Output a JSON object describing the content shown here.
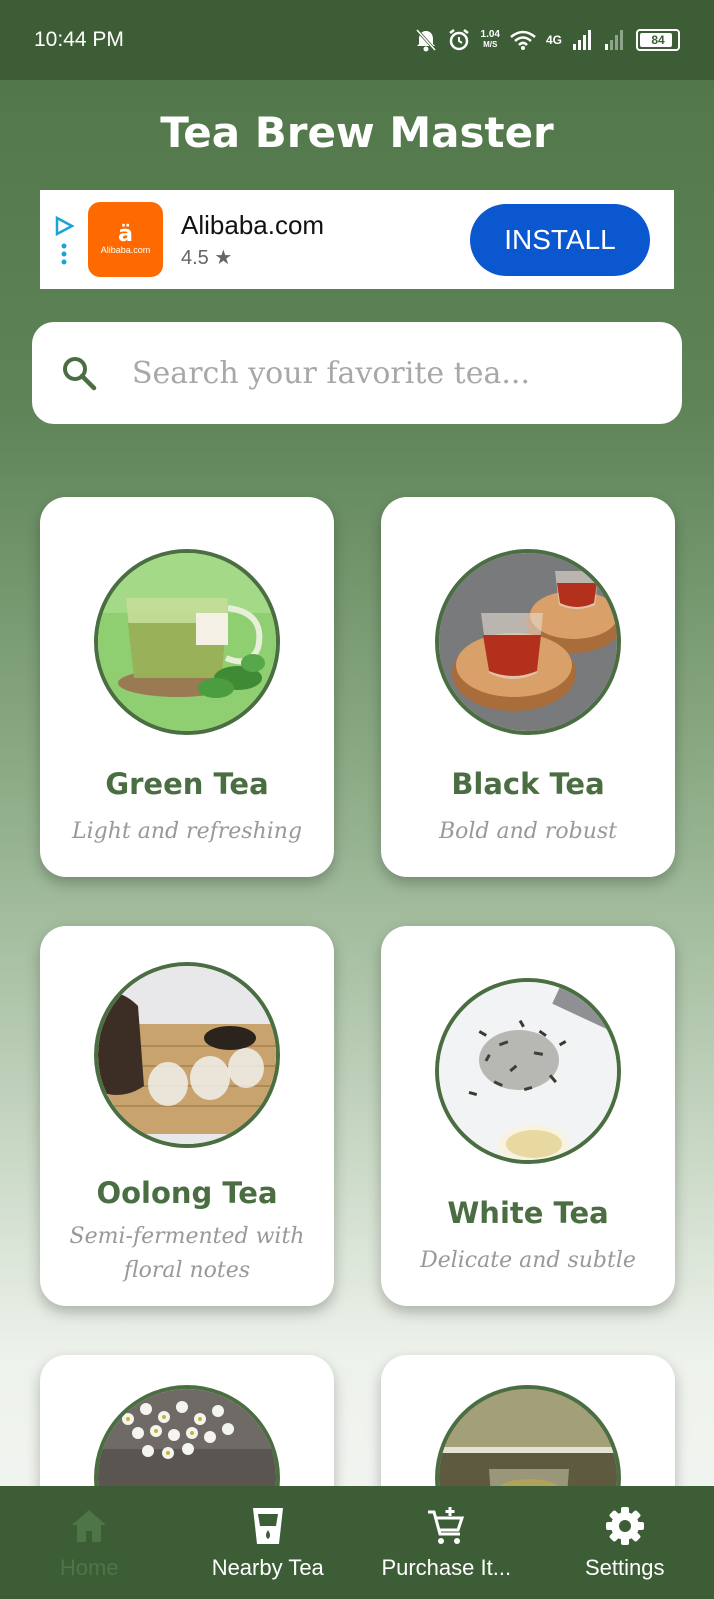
{
  "status": {
    "time": "10:44 PM",
    "speed_top": "1.04",
    "speed_unit": "M/S",
    "network": "4G",
    "battery": "84"
  },
  "app": {
    "title": "Tea Brew Master"
  },
  "ad": {
    "brand": "Alibaba.com",
    "logo_glyph": "ä",
    "logo_text": "Alibaba.com",
    "rating": "4.5 ★",
    "install_label": "INSTALL",
    "logo_color": "#ff6a00",
    "button_color": "#0b57d0"
  },
  "search": {
    "placeholder": "Search your favorite tea..."
  },
  "teas": [
    {
      "name": "Green Tea",
      "desc": "Light and refreshing",
      "image": "green-tea-cup"
    },
    {
      "name": "Black Tea",
      "desc": "Bold and robust",
      "image": "black-tea-glasses"
    },
    {
      "name": "Oolong Tea",
      "desc": "Semi-fermented with floral notes",
      "image": "oolong-tea-set"
    },
    {
      "name": "White Tea",
      "desc": "Delicate and subtle",
      "image": "white-tea-leaves"
    },
    {
      "name": "",
      "desc": "",
      "image": "chamomile-flowers"
    },
    {
      "name": "",
      "desc": "",
      "image": "herbal-tea-glass"
    }
  ],
  "nav": {
    "items": [
      {
        "label": "Home",
        "icon": "home-icon",
        "active": true
      },
      {
        "label": "Nearby Tea",
        "icon": "cup-icon",
        "active": false
      },
      {
        "label": "Purchase It...",
        "icon": "add-cart-icon",
        "active": false
      },
      {
        "label": "Settings",
        "icon": "gear-icon",
        "active": false
      }
    ]
  },
  "colors": {
    "primary": "#4a6e42",
    "bar": "#3d5d36",
    "accent_inactive": "#4d7546"
  }
}
